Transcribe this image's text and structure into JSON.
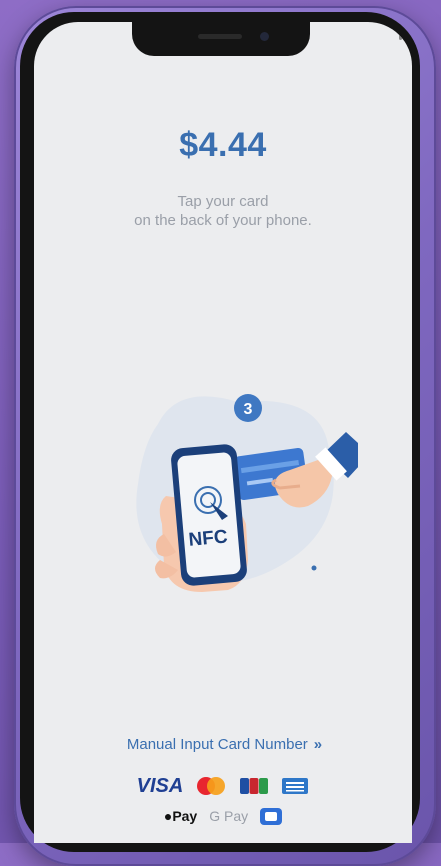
{
  "payment": {
    "amount": "$4.44",
    "instruction_line1": "Tap your card",
    "instruction_line2": "on the back of your phone."
  },
  "illustration": {
    "step_badge": "3",
    "nfc_label": "NFC"
  },
  "manual_input": {
    "label": "Manual Input Card Number",
    "chevron": "»"
  },
  "accepted_brands": {
    "visa": "VISA",
    "apple_pay": "Pay",
    "google_pay": "Pay"
  },
  "colors": {
    "accent": "#3a6fb0",
    "screen_bg": "#ecedef",
    "phone_frame": "#8a6fd0"
  }
}
